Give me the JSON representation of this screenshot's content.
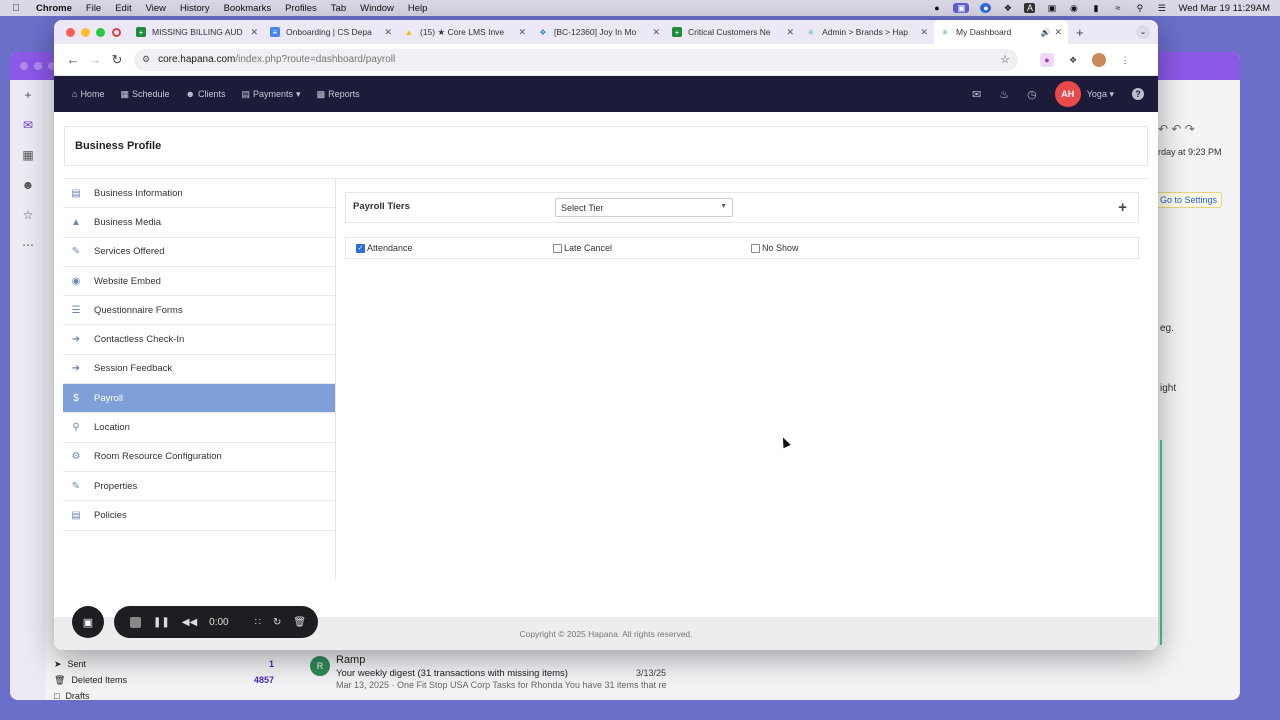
{
  "menubar": {
    "app": "Chrome",
    "items": [
      "File",
      "Edit",
      "View",
      "History",
      "Bookmarks",
      "Profiles",
      "Tab",
      "Window",
      "Help"
    ],
    "datetime": "Wed Mar 19  11:29AM"
  },
  "background": {
    "right_pane": {
      "date_text": "rday at 9:23 PM",
      "goto_settings": "Go to Settings",
      "text1": "eg.",
      "text2": "ight"
    },
    "folders": [
      {
        "label": "Sent",
        "count": "1"
      },
      {
        "label": "Deleted Items",
        "count": "4857"
      },
      {
        "label": "Drafts",
        "count": ""
      }
    ],
    "mail": {
      "avatar": "R",
      "from": "Ramp",
      "subject": "Your weekly digest (31 transactions with missing items)",
      "date": "3/13/25",
      "preview": "Mar 13, 2025 · One Fit Stop USA Corp Tasks for Rhonda You have 31 items that requir..."
    }
  },
  "tabs": [
    {
      "title": "MISSING BILLING AUD",
      "icon": "sheets-icon",
      "color": "#1e8e3e"
    },
    {
      "title": "Onboarding | CS Depa",
      "icon": "docs-icon",
      "color": "#4285f4"
    },
    {
      "title": "(15) ★ Core LMS Inve",
      "icon": "drive-icon",
      "color": "#f4b400"
    },
    {
      "title": "[BC-12360] Joy In Mo",
      "icon": "jira-icon",
      "color": "#2684ff"
    },
    {
      "title": "Critical Customers Ne",
      "icon": "sheets-icon",
      "color": "#1e8e3e"
    },
    {
      "title": "Admin > Brands > Hap",
      "icon": "hapana-icon",
      "color": "#3ab9a8"
    },
    {
      "title": "My Dashboard",
      "icon": "hapana-icon",
      "color": "#3ab9a8",
      "active": true
    }
  ],
  "address": {
    "host": "core.hapana.com",
    "path": "/index.php?route=dashboard/payroll"
  },
  "appnav": {
    "items": [
      "Home",
      "Schedule",
      "Clients",
      "Payments",
      "Reports"
    ],
    "user_initials": "AH",
    "user_name": "Yoga"
  },
  "page": {
    "title": "Business Profile",
    "menu": [
      {
        "label": "Business Information",
        "icon": "id-card-icon"
      },
      {
        "label": "Business Media",
        "icon": "media-icon"
      },
      {
        "label": "Services Offered",
        "icon": "services-icon"
      },
      {
        "label": "Website Embed",
        "icon": "globe-icon"
      },
      {
        "label": "Questionnaire Forms",
        "icon": "form-icon"
      },
      {
        "label": "Contactless Check-In",
        "icon": "sign-in-icon"
      },
      {
        "label": "Session Feedback",
        "icon": "feedback-icon"
      },
      {
        "label": "Payroll",
        "icon": "dollar-icon",
        "active": true
      },
      {
        "label": "Location",
        "icon": "map-pin-icon"
      },
      {
        "label": "Room Resource Configuration",
        "icon": "gear-icon"
      },
      {
        "label": "Properties",
        "icon": "edit-icon"
      },
      {
        "label": "Policies",
        "icon": "document-icon"
      }
    ],
    "payroll": {
      "tiers_label": "Payroll Tiers",
      "tier_select": "Select Tier",
      "options": [
        {
          "label": "Attendance",
          "checked": true
        },
        {
          "label": "Late Cancel",
          "checked": false
        },
        {
          "label": "No Show",
          "checked": false
        }
      ]
    },
    "footer": "Copyright © 2025 Hapana. All rights reserved."
  },
  "recorder": {
    "time": "0:00"
  }
}
